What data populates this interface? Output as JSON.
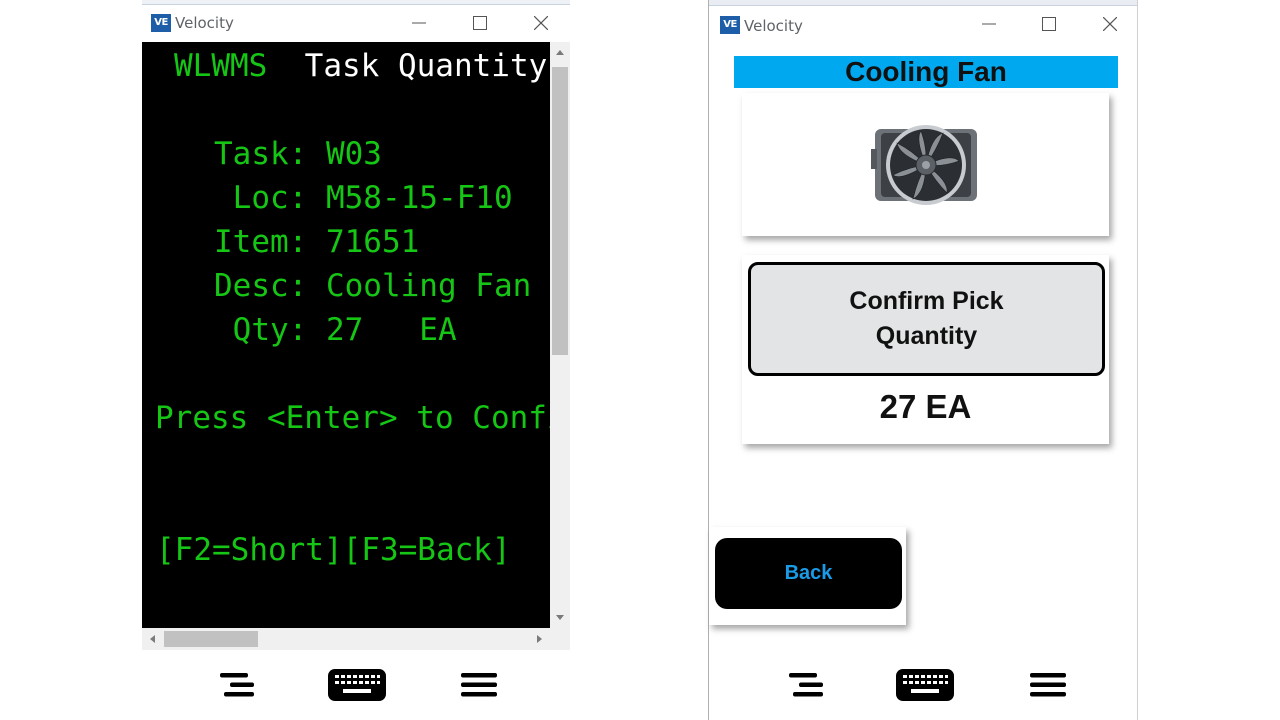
{
  "left_window": {
    "app_title": "Velocity",
    "logo_text": "VE",
    "window_controls": {
      "minimize": "minimize",
      "maximize": "maximize",
      "close": "close"
    },
    "terminal": {
      "header_app": "WLWMS",
      "header_title": "Task Quantity",
      "lines": [
        "Task: W03",
        " Loc: M58-15-F10",
        "Item: 71651",
        "Desc: Cooling Fan",
        " Qty: 27   EA"
      ],
      "prompt": "Press <Enter> to Confirm",
      "function_keys": "[F2=Short][F3=Back]"
    },
    "bottom_bar": [
      "menu-align-right",
      "keyboard",
      "hamburger-menu"
    ]
  },
  "right_window": {
    "app_title": "Velocity",
    "logo_text": "VE",
    "window_controls": {
      "minimize": "minimize",
      "maximize": "maximize",
      "close": "close"
    },
    "header": "Cooling Fan",
    "image_alt": "Cooling fan product image",
    "confirm_button": {
      "line1": "Confirm Pick",
      "line2": "Quantity"
    },
    "quantity": "27 EA",
    "back_button": "Back",
    "colors": {
      "header_band": "#00a8f0",
      "back_text": "#1a9be8",
      "terminal_green": "#15c615"
    },
    "bottom_bar": [
      "menu-align-right",
      "keyboard",
      "hamburger-menu"
    ]
  }
}
